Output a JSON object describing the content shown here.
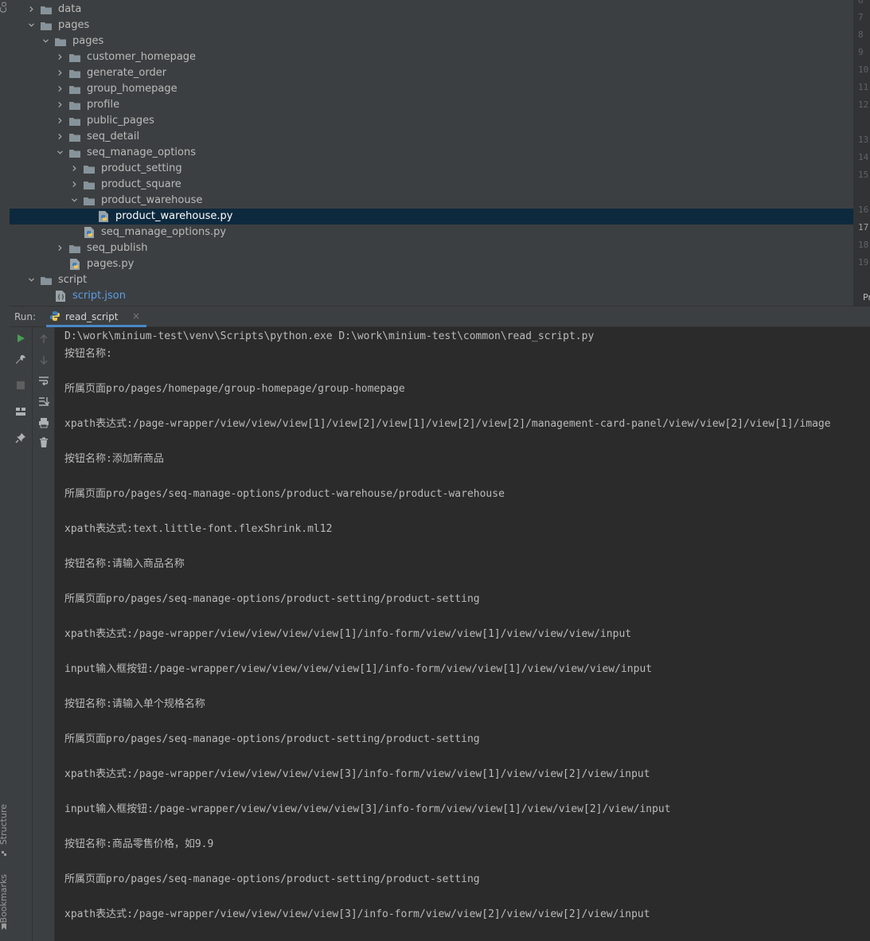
{
  "side_tabs": {
    "top": "Co",
    "structure": "Structure",
    "bookmarks": "Bookmarks"
  },
  "tree": [
    {
      "label": "data",
      "depth": 0,
      "type": "folder",
      "expanded": false
    },
    {
      "label": "pages",
      "depth": 0,
      "type": "folder",
      "expanded": true
    },
    {
      "label": "pages",
      "depth": 1,
      "type": "folder",
      "expanded": true
    },
    {
      "label": "customer_homepage",
      "depth": 2,
      "type": "folder",
      "expanded": false
    },
    {
      "label": "generate_order",
      "depth": 2,
      "type": "folder",
      "expanded": false
    },
    {
      "label": "group_homepage",
      "depth": 2,
      "type": "folder",
      "expanded": false
    },
    {
      "label": "profile",
      "depth": 2,
      "type": "folder",
      "expanded": false
    },
    {
      "label": "public_pages",
      "depth": 2,
      "type": "folder",
      "expanded": false
    },
    {
      "label": "seq_detail",
      "depth": 2,
      "type": "folder",
      "expanded": false
    },
    {
      "label": "seq_manage_options",
      "depth": 2,
      "type": "folder",
      "expanded": true
    },
    {
      "label": "product_setting",
      "depth": 3,
      "type": "folder",
      "expanded": false
    },
    {
      "label": "product_square",
      "depth": 3,
      "type": "folder",
      "expanded": false
    },
    {
      "label": "product_warehouse",
      "depth": 3,
      "type": "folder",
      "expanded": true
    },
    {
      "label": "product_warehouse.py",
      "depth": 4,
      "type": "py",
      "selected": true
    },
    {
      "label": "seq_manage_options.py",
      "depth": 3,
      "type": "py"
    },
    {
      "label": "seq_publish",
      "depth": 2,
      "type": "folder",
      "expanded": false
    },
    {
      "label": "pages.py",
      "depth": 2,
      "type": "py"
    },
    {
      "label": "script",
      "depth": 0,
      "type": "folder",
      "expanded": true
    },
    {
      "label": "script.json",
      "depth": 1,
      "type": "json"
    }
  ],
  "editor_line_numbers": [
    {
      "n": "6",
      "cur": false
    },
    {
      "n": "7",
      "cur": false
    },
    {
      "n": "8",
      "cur": false
    },
    {
      "n": "9",
      "cur": false
    },
    {
      "n": "10",
      "cur": false
    },
    {
      "n": "11",
      "cur": false
    },
    {
      "n": "12",
      "cur": false
    },
    {
      "n": "13",
      "cur": false
    },
    {
      "n": "14",
      "cur": false
    },
    {
      "n": "15",
      "cur": false
    },
    {
      "n": "16",
      "cur": false
    },
    {
      "n": "17",
      "cur": true
    },
    {
      "n": "18",
      "cur": false
    },
    {
      "n": "19",
      "cur": false
    }
  ],
  "editor_hint": "Pr",
  "run_panel": {
    "label": "Run:",
    "tab_label": "read_script",
    "tab_close": "×"
  },
  "console_lines": [
    "D:\\work\\minium-test\\venv\\Scripts\\python.exe D:\\work\\minium-test\\common\\read_script.py",
    "按钮名称:",
    "",
    "所属页面pro/pages/homepage/group-homepage/group-homepage",
    "",
    "xpath表达式:/page-wrapper/view/view/view[1]/view[2]/view[1]/view[2]/view[2]/management-card-panel/view/view[2]/view[1]/image",
    "",
    "按钮名称:添加新商品",
    "",
    "所属页面pro/pages/seq-manage-options/product-warehouse/product-warehouse",
    "",
    "xpath表达式:text.little-font.flexShrink.ml12",
    "",
    "按钮名称:请输入商品名称",
    "",
    "所属页面pro/pages/seq-manage-options/product-setting/product-setting",
    "",
    "xpath表达式:/page-wrapper/view/view/view/view[1]/info-form/view/view[1]/view/view/view/input",
    "",
    "input输入框按钮:/page-wrapper/view/view/view/view[1]/info-form/view/view[1]/view/view/view/input",
    "",
    "按钮名称:请输入单个规格名称",
    "",
    "所属页面pro/pages/seq-manage-options/product-setting/product-setting",
    "",
    "xpath表达式:/page-wrapper/view/view/view/view[3]/info-form/view/view[1]/view/view[2]/view/input",
    "",
    "input输入框按钮:/page-wrapper/view/view/view/view[3]/info-form/view/view[1]/view/view[2]/view/input",
    "",
    "按钮名称:商品零售价格，如9.9",
    "",
    "所属页面pro/pages/seq-manage-options/product-setting/product-setting",
    "",
    "xpath表达式:/page-wrapper/view/view/view/view[3]/info-form/view/view[2]/view/view[2]/view/input"
  ],
  "colors": {
    "selection": "#0d293e",
    "folder": "#87939a",
    "run_green": "#499c54",
    "tab_underline": "#4a88c7"
  }
}
